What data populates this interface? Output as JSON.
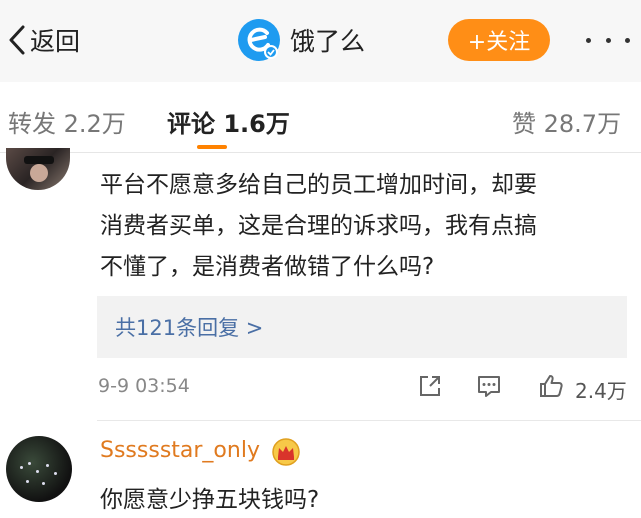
{
  "header": {
    "back_label": "返回",
    "app_name": "饿了么",
    "follow_label": "+关注",
    "brand_color": "#1e9bf0",
    "follow_color": "#ff8e16"
  },
  "tabs": [
    {
      "label": "转发 2.2万",
      "active": false
    },
    {
      "label": "评论 1.6万",
      "active": true
    },
    {
      "label": "赞 28.7万",
      "active": false
    }
  ],
  "comments": [
    {
      "lines": [
        "平台不愿意多给自己的员工增加时间，却要",
        "消费者买单，这是合理的诉求吗，我有点搞",
        "不懂了，是消费者做错了什么吗?"
      ],
      "replies_label": "共121条回复 >",
      "time": "9-9 03:54",
      "like_count": "2.4万"
    },
    {
      "username": "Sssssstar_only",
      "text": "你愿意少挣五块钱吗?"
    }
  ],
  "icons": {
    "back": "chevron-left-icon",
    "more": "more-dots-icon",
    "share": "share-icon",
    "reply": "comment-icon",
    "like": "thumbs-up-icon",
    "crown": "crown-badge-icon"
  }
}
